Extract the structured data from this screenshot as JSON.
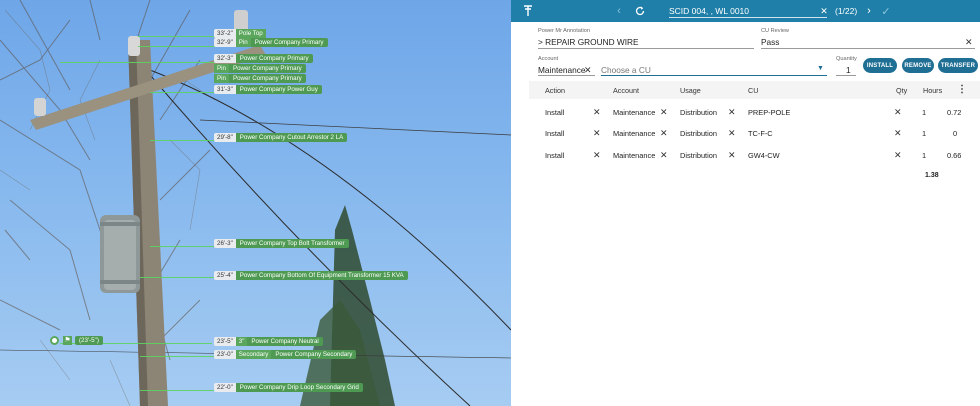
{
  "photo": {
    "tags": [
      {
        "h": "33'-2\"",
        "p": "Pole Top",
        "n": ""
      },
      {
        "h": "32'-9\"",
        "p": "Pin",
        "n": "Power Company Primary"
      },
      {
        "h": "32'-3\"",
        "p": "",
        "n": "Power Company Primary"
      },
      {
        "h": "",
        "p": "Pin",
        "n": "Power Company Primary"
      },
      {
        "h": "",
        "p": "Pin",
        "n": "Power Company Primary"
      },
      {
        "h": "31'-3\"",
        "p": "",
        "n": "Power Company Power Guy"
      },
      {
        "h": "29'-8\"",
        "p": "",
        "n": "Power Company Cutout Arrestor 2 LA"
      },
      {
        "h": "26'-3\"",
        "p": "",
        "n": "Power Company Top Bolt Transformer"
      },
      {
        "h": "25'-4\"",
        "p": "",
        "n": "Power Company Bottom Of Equipment Transformer 15 KVA"
      },
      {
        "h": "23'-5\"",
        "p": "3\"",
        "n": "Power Company Neutral"
      },
      {
        "h": "23'-0\"",
        "p": "Secondary",
        "n": "Power Company Secondary"
      },
      {
        "h": "22'-0\"",
        "p": "",
        "n": "Power Company Drip Loop Secondary Grid"
      }
    ],
    "ground_tag": "(23'-5\")"
  },
  "topbar": {
    "scid": "SCID 004, , WL 0010",
    "counter": "(1/22)",
    "icons": {
      "logo": "tower-icon",
      "prev": "chevron-left-icon",
      "refresh": "refresh-icon",
      "clear": "close-icon",
      "next": "chevron-right-icon",
      "confirm": "check-icon"
    }
  },
  "form": {
    "annotation_label": "Power Mr Annotation",
    "annotation_value": "> REPAIR GROUND WIRE",
    "review_label": "CU Review",
    "review_value": "Pass",
    "account_label": "Account",
    "account_value": "Maintenance",
    "cu_placeholder": "Choose a CU",
    "quantity_label": "Quantity",
    "quantity_value": "1"
  },
  "buttons": {
    "install": "INSTALL",
    "remove": "REMOVE",
    "transfer": "TRANSFER"
  },
  "table": {
    "headers": {
      "action": "Action",
      "account": "Account",
      "usage": "Usage",
      "cu": "CU",
      "qty": "Qty",
      "hours": "Hours"
    },
    "rows": [
      {
        "action": "Install",
        "account": "Maintenance",
        "usage": "Distribution",
        "cu": "PREP-POLE",
        "qty": "1",
        "hours": "0.72"
      },
      {
        "action": "Install",
        "account": "Maintenance",
        "usage": "Distribution",
        "cu": "TC-F-C",
        "qty": "1",
        "hours": "0"
      },
      {
        "action": "Install",
        "account": "Maintenance",
        "usage": "Distribution",
        "cu": "GW4-CW",
        "qty": "1",
        "hours": "0.66"
      }
    ],
    "total_hours": "1.38"
  },
  "colors": {
    "topbar": "#1f7fa8",
    "button": "#1f6e94",
    "tag_green": "#5aa65d"
  }
}
